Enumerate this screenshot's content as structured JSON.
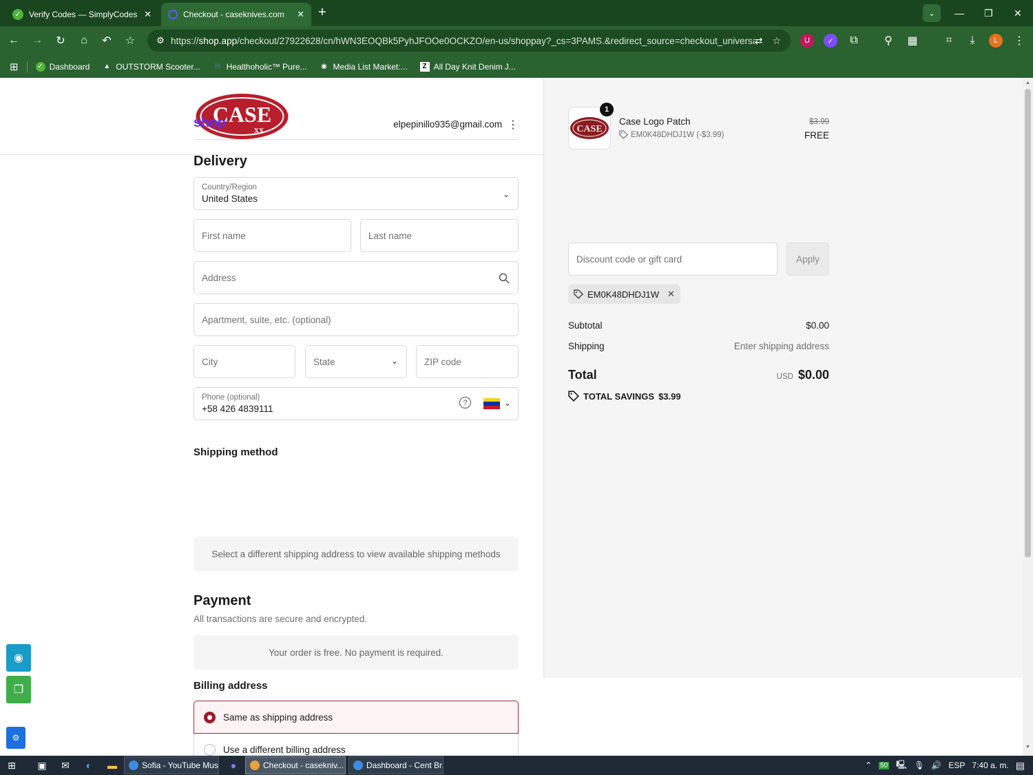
{
  "browser": {
    "tabs": [
      {
        "title": "Verify Codes — SimplyCodes",
        "active": false
      },
      {
        "title": "Checkout - caseknives.com",
        "active": true
      }
    ],
    "url_prefix": "https://",
    "url_host": "shop.app",
    "url_path": "/checkout/27922628/cn/hWN3EOQBk5PyhJFOOe0OCKZO/en-us/shoppay?_cs=3PAMS.&redirect_source=checkout_universal...",
    "bookmarks": [
      {
        "label": "Dashboard",
        "icon": "simplycodes-icon"
      },
      {
        "label": "OUTSTORM Scooter...",
        "icon": "outstorm-icon"
      },
      {
        "label": "Healthoholic™ Pure...",
        "icon": "healthoholic-icon"
      },
      {
        "label": "Media List Market:...",
        "icon": "globe-icon"
      },
      {
        "label": "All Day Knit Denim J...",
        "icon": "z-icon"
      }
    ],
    "profile_initial": "L",
    "colors": {
      "chrome": "#19461f",
      "toolbar": "#2a6230"
    }
  },
  "store": {
    "logo_text": "CASE",
    "logo_sub": "XX",
    "brand_color": "#b81e2c"
  },
  "checkout": {
    "shop_logo": "shop",
    "email": "elpepinillo935@gmail.com",
    "delivery": {
      "title": "Delivery",
      "country_label": "Country/Region",
      "country_value": "United States",
      "first_name_placeholder": "First name",
      "last_name_placeholder": "Last name",
      "address_placeholder": "Address",
      "apartment_placeholder": "Apartment, suite, etc. (optional)",
      "city_placeholder": "City",
      "state_placeholder": "State",
      "zip_placeholder": "ZIP code",
      "phone_label": "Phone (optional)",
      "phone_value": "+58 426 4839111"
    },
    "shipping_method": {
      "title": "Shipping method",
      "message": "Select a different shipping address to view available shipping methods"
    },
    "payment": {
      "title": "Payment",
      "subtitle": "All transactions are secure and encrypted.",
      "message": "Your order is free. No payment is required."
    },
    "billing": {
      "title": "Billing address",
      "option_same": "Same as shipping address",
      "option_different": "Use a different billing address"
    }
  },
  "summary": {
    "item": {
      "quantity": "1",
      "name": "Case Logo Patch",
      "discount_code": "EM0K48DHDJ1W (-$3.99)",
      "original_price": "$3.99",
      "price": "FREE"
    },
    "discount_placeholder": "Discount code or gift card",
    "apply_label": "Apply",
    "applied_code": "EM0K48DHDJ1W",
    "subtotal_label": "Subtotal",
    "subtotal_value": "$0.00",
    "shipping_label": "Shipping",
    "shipping_value": "Enter shipping address",
    "total_label": "Total",
    "currency": "USD",
    "total_value": "$0.00",
    "savings_label": "TOTAL SAVINGS",
    "savings_value": "$3.99"
  },
  "taskbar": {
    "windows": [
      {
        "title": "Sofia - YouTube Mus...",
        "active": false
      },
      {
        "title": "Checkout - casekniv...",
        "active": true
      },
      {
        "title": "Dashboard - Cent Br...",
        "active": false
      }
    ],
    "battery": "50",
    "language": "ESP",
    "time": "7:40 a. m."
  }
}
